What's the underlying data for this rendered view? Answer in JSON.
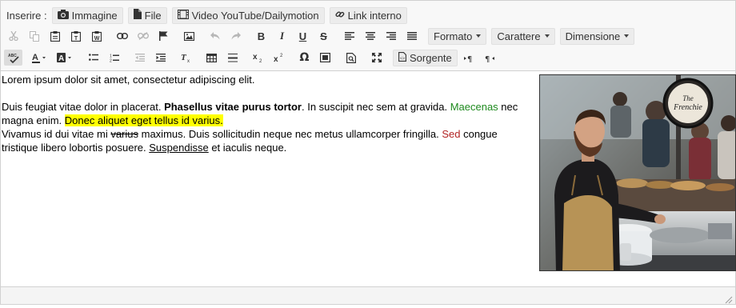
{
  "toolbar": {
    "insert_label": "Inserire :",
    "insert_buttons": {
      "image": "Immagine",
      "file": "File",
      "video": "Video YouTube/Dailymotion",
      "link": "Link interno"
    },
    "dropdowns": {
      "format": "Formato",
      "font": "Carattere",
      "size": "Dimensione"
    },
    "source_label": "Sorgente",
    "icons": [
      "cut-icon",
      "copy-icon",
      "paste-icon",
      "paste-text-icon",
      "paste-word-icon",
      "link-icon",
      "unlink-icon",
      "anchor-icon",
      "image-icon",
      "undo-icon",
      "redo-icon",
      "bold-icon",
      "italic-icon",
      "underline-icon",
      "strike-icon",
      "align-left-icon",
      "align-center-icon",
      "align-right-icon",
      "justify-icon",
      "spellcheck-icon",
      "text-color-icon",
      "bg-color-icon",
      "bulleted-list-icon",
      "numbered-list-icon",
      "outdent-icon",
      "indent-icon",
      "remove-format-icon",
      "table-icon",
      "horizontal-rule-icon",
      "subscript-icon",
      "superscript-icon",
      "special-char-icon",
      "iframe-icon",
      "preview-icon",
      "maximize-icon",
      "source-icon",
      "ltr-icon",
      "rtl-icon"
    ]
  },
  "content": {
    "p1": "Lorem ipsum dolor sit amet, consectetur adipiscing elit.",
    "p2": {
      "t1": "Duis feugiat vitae dolor in placerat. ",
      "bold": "Phasellus vitae purus tortor",
      "t2": ". In suscipit nec sem at gravida. ",
      "green": "Maecenas",
      "t3": " nec magna enim. ",
      "highlight": "Donec aliquet eget tellus id varius."
    },
    "p3": {
      "t1": "Vivamus id dui vitae mi ",
      "strike": "varius",
      "t2": " maximus. Duis sollicitudin neque nec metus ullamcorper fringilla. ",
      "red": "Sed",
      "t3": " congue tristique libero lobortis posuere. ",
      "underline": "Suspendisse",
      "t4": " et iaculis neque."
    },
    "image_sign_text": "The Frenchie",
    "colors": {
      "green": "#1e8a1e",
      "red": "#b22222",
      "highlight": "#ffff00"
    }
  }
}
